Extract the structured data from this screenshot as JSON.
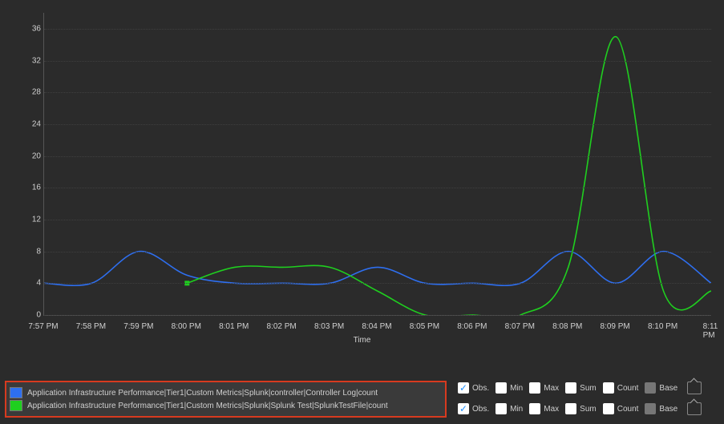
{
  "chart_data": {
    "type": "line",
    "xlabel": "Time",
    "ylabel": "",
    "ylim": [
      0,
      38
    ],
    "categories": [
      "7:57 PM",
      "7:58 PM",
      "7:59 PM",
      "8:00 PM",
      "8:01 PM",
      "8:02 PM",
      "8:03 PM",
      "8:04 PM",
      "8:05 PM",
      "8:06 PM",
      "8:07 PM",
      "8:08 PM",
      "8:09 PM",
      "8:10 PM",
      "8:11 PM"
    ],
    "y_ticks": [
      0,
      4,
      8,
      12,
      16,
      20,
      24,
      28,
      32,
      36
    ],
    "series": [
      {
        "name": "Application Infrastructure Performance|Tier1|Custom Metrics|Splunk|controller|Controller Log|count",
        "color": "#2e6ff0",
        "values": [
          4,
          4,
          8,
          5,
          4,
          4,
          4,
          6,
          4,
          4,
          4,
          8,
          4,
          8,
          4
        ]
      },
      {
        "name": "Application Infrastructure Performance|Tier1|Custom Metrics|Splunk|Splunk Test|SplunkTestFile|count",
        "color": "#1fcf1f",
        "values": [
          null,
          null,
          null,
          4,
          6,
          6,
          6,
          3,
          0,
          0,
          0,
          6,
          35,
          3,
          3
        ]
      }
    ]
  },
  "legend": {
    "items": [
      {
        "color": "#2e6ff0",
        "label": "Application Infrastructure Performance|Tier1|Custom Metrics|Splunk|controller|Controller Log|count"
      },
      {
        "color": "#1fcf1f",
        "label": "Application Infrastructure Performance|Tier1|Custom Metrics|Splunk|Splunk Test|SplunkTestFile|count"
      }
    ]
  },
  "options": {
    "labels": {
      "obs": "Obs.",
      "min": "Min",
      "max": "Max",
      "sum": "Sum",
      "count": "Count",
      "base": "Base"
    },
    "rows": [
      {
        "obs": true,
        "min": false,
        "max": false,
        "sum": false,
        "count": false,
        "base": "disabled"
      },
      {
        "obs": true,
        "min": false,
        "max": false,
        "sum": false,
        "count": false,
        "base": "disabled"
      }
    ]
  }
}
